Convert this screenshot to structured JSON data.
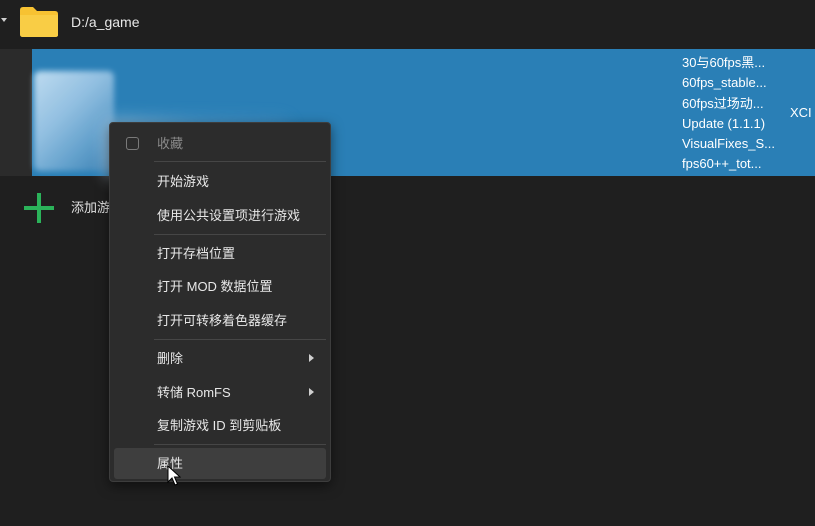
{
  "folder": {
    "path": "D:/a_game",
    "icon": "folder-icon",
    "color": "#f7c232"
  },
  "game": {
    "selection_color": "#2a7fb6",
    "mods": [
      "30与60fps黑...",
      "60fps_stable...",
      "60fps过场动...",
      "Update (1.1.1)",
      "VisualFixes_S...",
      "fps60++_tot..."
    ],
    "file_type": "XCI"
  },
  "add_game": {
    "label": "添加游",
    "icon": "plus-icon",
    "color": "#2bb35a"
  },
  "context_menu": {
    "favorite": "收藏",
    "start_game": "开始游戏",
    "start_global": "使用公共设置项进行游戏",
    "open_save": "打开存档位置",
    "open_mod": "打开 MOD 数据位置",
    "open_shader": "打开可转移着色器缓存",
    "delete": "删除",
    "dump_romfs": "转储 RomFS",
    "copy_id": "复制游戏 ID 到剪贴板",
    "properties": "属性"
  }
}
